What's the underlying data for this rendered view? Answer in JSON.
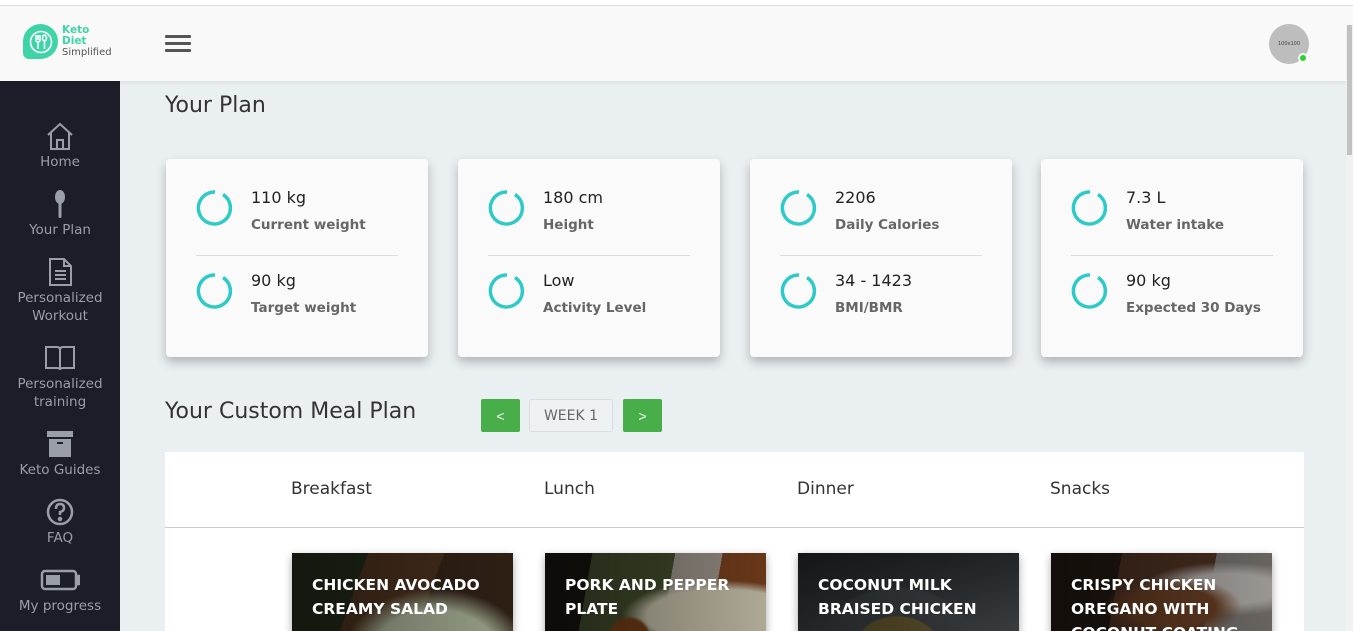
{
  "header": {
    "logo": {
      "line1": "Keto",
      "line2": "Diet",
      "line3": "Simplified"
    },
    "menu_icon": "hamburger-icon",
    "avatar": {
      "placeholder_text": "100x100",
      "status_color": "#2ed12e",
      "status": "online"
    }
  },
  "sidebar": {
    "items": [
      {
        "label": "Home",
        "icon": "home-icon"
      },
      {
        "label": "Your Plan",
        "icon": "spoon-icon"
      },
      {
        "label": "Personalized Workout",
        "icon": "document-icon"
      },
      {
        "label": "Personalized training",
        "icon": "book-icon"
      },
      {
        "label": "Keto Guides",
        "icon": "archive-box-icon"
      },
      {
        "label": "FAQ",
        "icon": "question-circle-icon"
      },
      {
        "label": "My progress",
        "icon": "battery-icon"
      }
    ]
  },
  "plan": {
    "title": "Your Plan",
    "accent_color": "#2ec9c9",
    "cards": [
      {
        "stats": [
          {
            "value": "110 kg",
            "label": "Current weight"
          },
          {
            "value": "90 kg",
            "label": "Target weight"
          }
        ]
      },
      {
        "stats": [
          {
            "value": "180 cm",
            "label": "Height"
          },
          {
            "value": "Low",
            "label": "Activity Level"
          }
        ]
      },
      {
        "stats": [
          {
            "value": "2206",
            "label": "Daily Calories"
          },
          {
            "value": "34 - 1423",
            "label": "BMI/BMR"
          }
        ]
      },
      {
        "stats": [
          {
            "value": "7.3 L",
            "label": "Water intake"
          },
          {
            "value": "90 kg",
            "label": "Expected 30 Days"
          }
        ]
      }
    ]
  },
  "meal_plan": {
    "title": "Your Custom Meal Plan",
    "prev_label": "<",
    "next_label": ">",
    "week_label": "WEEK 1",
    "button_color": "#47ae4a",
    "columns": [
      "Breakfast",
      "Lunch",
      "Dinner",
      "Snacks"
    ],
    "meals": [
      {
        "name": "Chicken Avocado Creamy Salad"
      },
      {
        "name": "Pork and Pepper Plate"
      },
      {
        "name": "Coconut Milk Braised Chicken"
      },
      {
        "name": "Crispy Chicken Oregano with Coconut Coating"
      }
    ]
  }
}
